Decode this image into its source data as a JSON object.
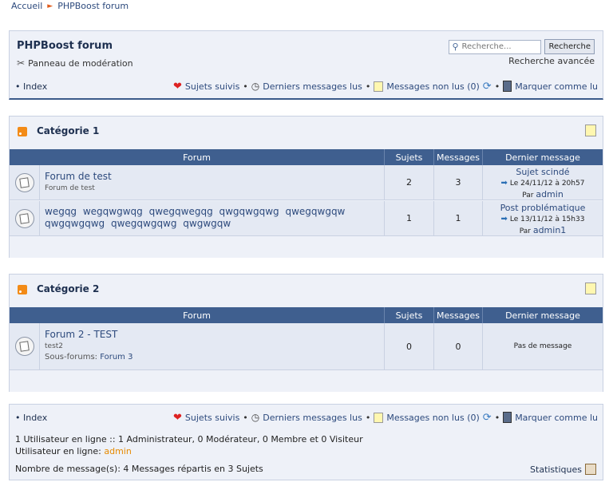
{
  "breadcrumb": {
    "home": "Accueil",
    "current": "PHPBoost forum"
  },
  "header": {
    "title": "PHPBoost forum",
    "moderation": "Panneau de modération",
    "search_placeholder": "Recherche...",
    "search_button": "Recherche",
    "advanced_search": "Recherche avancée"
  },
  "nav": {
    "index": "• Index",
    "followed": "Sujets suivis",
    "last_read": "Derniers messages lus",
    "unread": "Messages non lus (0)",
    "mark": "Marquer comme lu",
    "sep": "•"
  },
  "table_headers": {
    "forum": "Forum",
    "topics": "Sujets",
    "messages": "Messages",
    "last": "Dernier message"
  },
  "categories": [
    {
      "title": "Catégorie 1",
      "forums": [
        {
          "name": "Forum de test",
          "desc": "Forum de test",
          "topics": "2",
          "messages": "3",
          "last_title": "Sujet scindé",
          "last_date": "Le 24/11/12 à 20h57",
          "by": "Par",
          "author": "admin"
        },
        {
          "name": "wegqg wegqwgwqg qwegqwegqg qwgqwgqwg qwegqwgqw qwgqwgqwg qwegqwgqwg qwgwgqw",
          "desc": "",
          "topics": "1",
          "messages": "1",
          "last_title": "Post problématique",
          "last_date": "Le 13/11/12 à 15h33",
          "by": "Par",
          "author": "admin1"
        }
      ]
    },
    {
      "title": "Catégorie 2",
      "forums": [
        {
          "name": "Forum 2 - TEST",
          "desc": "test2",
          "subforums_label": "Sous-forums:",
          "subforum": "Forum 3",
          "topics": "0",
          "messages": "0",
          "no_message": "Pas de message"
        }
      ]
    }
  ],
  "stats": {
    "online_line": "1 Utilisateur en ligne :: 1 Administrateur, 0 Modérateur, 0 Membre et 0 Visiteur",
    "online_users_label": "Utilisateur en ligne:",
    "online_user": "admin",
    "messages_line": "Nombre de message(s): 4 Messages répartis en 3 Sujets",
    "stats_link": "Statistiques"
  }
}
